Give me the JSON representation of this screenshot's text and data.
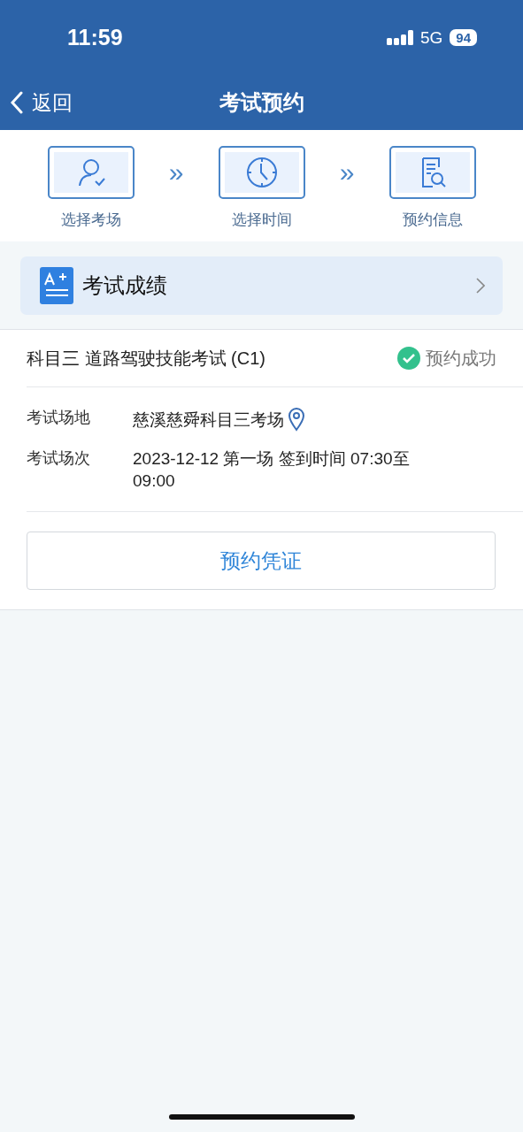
{
  "status_bar": {
    "time": "11:59",
    "network": "5G",
    "battery": "94"
  },
  "nav": {
    "back": "返回",
    "title": "考试预约"
  },
  "steps": [
    {
      "kind": "person",
      "label": "选择考场",
      "separator": "»"
    },
    {
      "kind": "clock",
      "label": "选择时间",
      "separator": "»"
    },
    {
      "kind": "document",
      "label": "预约信息"
    }
  ],
  "score_entry": {
    "label": "考试成绩"
  },
  "exam": {
    "title": "科目三 道路驾驶技能考试 (C1)",
    "status": {
      "kind": "success",
      "label": "预约成功"
    },
    "fields": [
      {
        "label": "考试场地",
        "value": "慈溪慈舜科目三考场",
        "kind": "location"
      },
      {
        "label": "考试场次",
        "value": "2023-12-12 第一场 签到时间 07:30至 09:00",
        "kind": "text"
      }
    ],
    "button": "预约凭证"
  }
}
